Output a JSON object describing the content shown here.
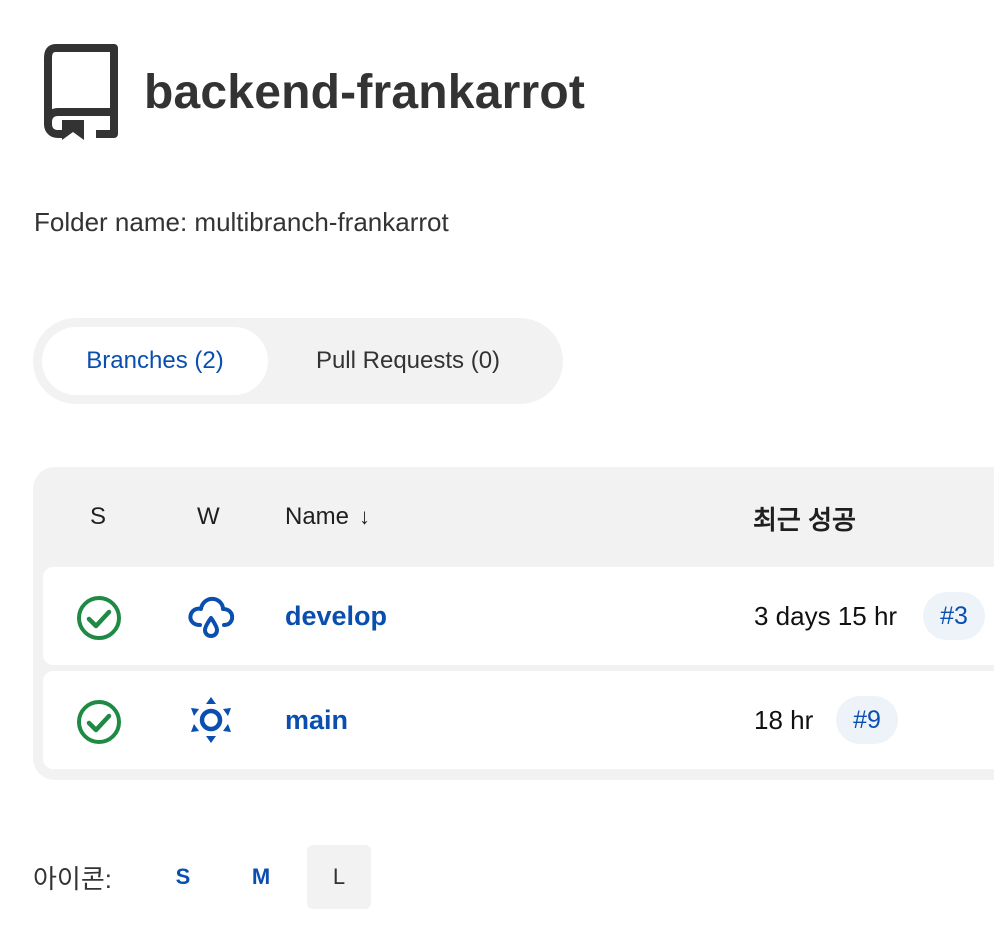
{
  "header": {
    "title": "backend-frankarrot",
    "icon": "book-icon"
  },
  "folder_name": "Folder name: multibranch-frankarrot",
  "tabs": [
    {
      "label": "Branches (2)",
      "active": true
    },
    {
      "label": "Pull Requests (0)",
      "active": false
    }
  ],
  "table": {
    "headers": {
      "s": "S",
      "w": "W",
      "name": "Name",
      "sort_arrow": "↓",
      "last_success": "최근 성공"
    },
    "rows": [
      {
        "status": "success-icon",
        "weather": "cloud-rain-icon",
        "name": "develop",
        "last_success": "3 days 15 hr",
        "build": "#3"
      },
      {
        "status": "success-icon",
        "weather": "sun-icon",
        "name": "main",
        "last_success": "18 hr",
        "build": "#9"
      }
    ]
  },
  "icon_size": {
    "label": "아이콘:",
    "options": [
      "S",
      "M",
      "L"
    ],
    "selected": "L"
  },
  "colors": {
    "accent": "#0a4fb0",
    "success": "#1e8a44",
    "panel_bg": "#f2f2f2"
  }
}
